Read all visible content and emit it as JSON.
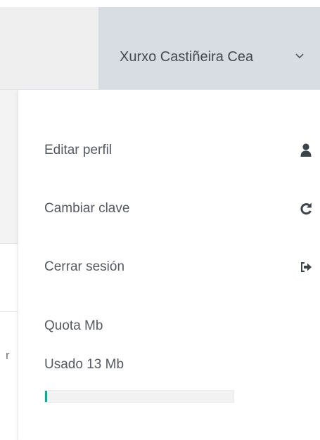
{
  "header": {
    "user_name": "Xurxo Castiñeira Cea"
  },
  "background": {
    "partial_text": "r"
  },
  "menu": {
    "items": [
      {
        "label": "Editar perfil",
        "icon": "user-icon"
      },
      {
        "label": "Cambiar clave",
        "icon": "refresh-icon"
      },
      {
        "label": "Cerrar sesión",
        "icon": "sign-out-icon"
      }
    ]
  },
  "quota": {
    "title": "Quota Mb",
    "used_label": "Usado 13 Mb",
    "progress_fraction": 0.01,
    "fill_color": "#1aa68e"
  }
}
